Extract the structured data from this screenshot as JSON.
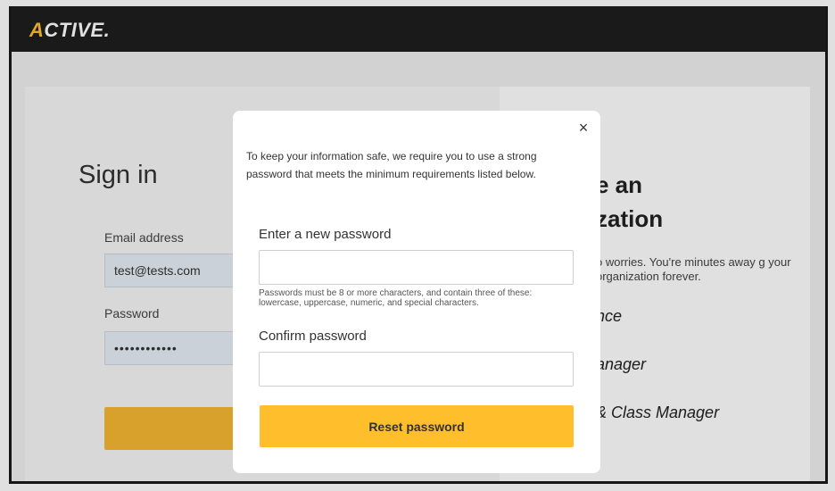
{
  "header": {
    "logo_text": "ACTIVE",
    "logo_mark": "A",
    "logo_rest": "CTIVE."
  },
  "signin": {
    "title": "Sign in",
    "email_label": "Email address",
    "email_value": "test@tests.com",
    "password_label": "Password",
    "password_value": "••••••••••••"
  },
  "organization": {
    "title_line1": "e an",
    "title_line2": "zation",
    "desc": "o worries. You're minutes away g your organization forever.",
    "products": [
      "nce",
      "anager",
      "& Class Manager"
    ]
  },
  "modal": {
    "close_label": "×",
    "intro": "To keep your information safe, we require you to use a strong password that meets the minimum requirements listed below.",
    "new_password_label": "Enter a new password",
    "new_password_value": "",
    "hint": "Passwords must be 8 or more characters, and contain three of these: lowercase, uppercase, numeric, and special characters.",
    "confirm_password_label": "Confirm password",
    "confirm_password_value": "",
    "reset_label": "Reset password"
  },
  "colors": {
    "accent": "#ffbe2b",
    "topbar": "#1e1e1e"
  }
}
